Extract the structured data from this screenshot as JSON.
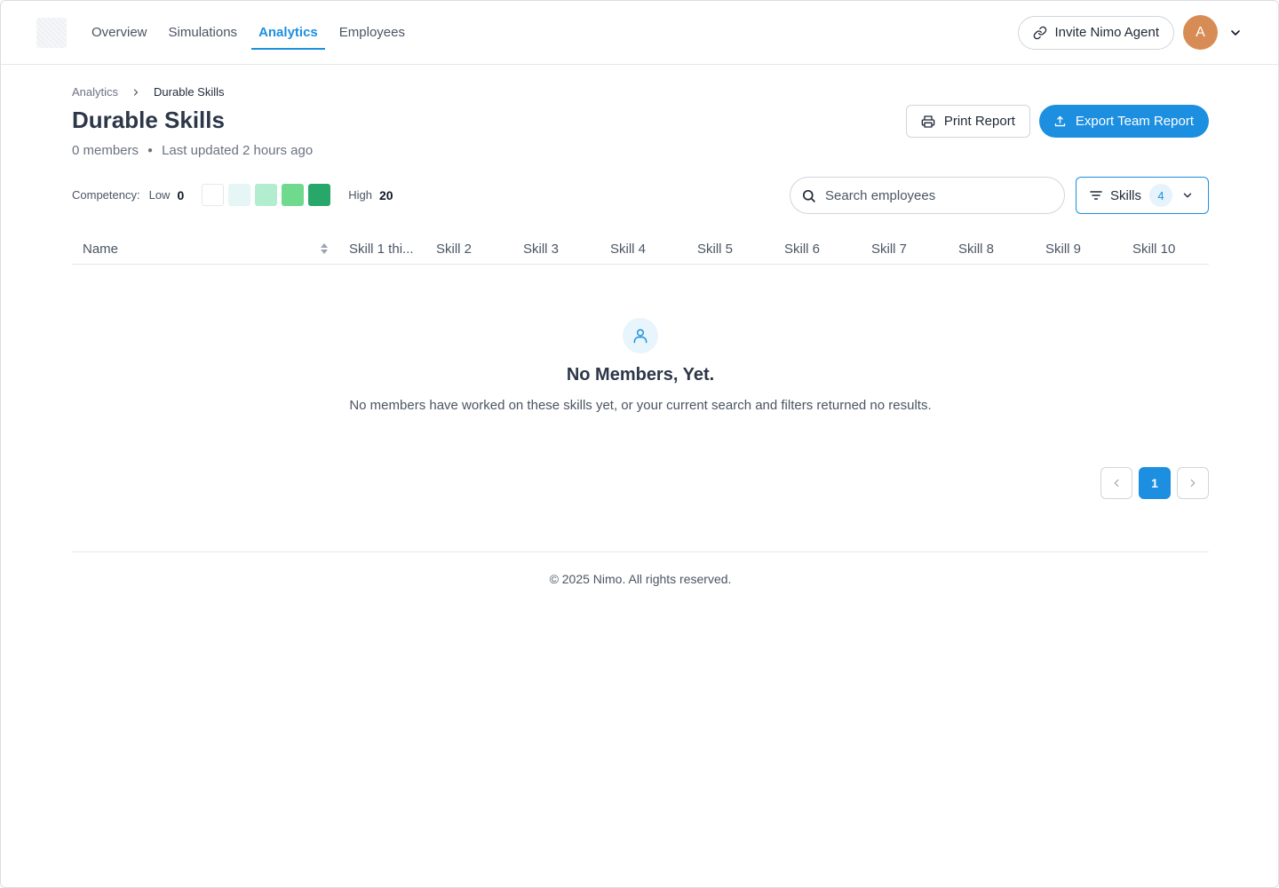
{
  "nav": {
    "items": [
      {
        "label": "Overview",
        "active": false
      },
      {
        "label": "Simulations",
        "active": false
      },
      {
        "label": "Analytics",
        "active": true
      },
      {
        "label": "Employees",
        "active": false
      }
    ],
    "invite_label": "Invite Nimo Agent",
    "avatar_initial": "A",
    "accent_color": "#1d8fe0",
    "avatar_color": "#d88c55"
  },
  "breadcrumb": {
    "parent": "Analytics",
    "current": "Durable Skills"
  },
  "page": {
    "title": "Durable Skills",
    "members": "0 members",
    "updated": "Last updated 2 hours ago",
    "print_label": "Print Report",
    "export_label": "Export Team Report"
  },
  "legend": {
    "label": "Competency:",
    "low_label": "Low",
    "low_value": "0",
    "high_label": "High",
    "high_value": "20",
    "swatch_colors": [
      "#ffffff",
      "#e6f5f6",
      "#b3edcf",
      "#6fd98e",
      "#27a86a"
    ]
  },
  "search": {
    "placeholder": "Search employees"
  },
  "skills_filter": {
    "label": "Skills",
    "count": "4"
  },
  "table": {
    "name_header": "Name",
    "skill_headers": [
      "Skill 1 thi...",
      "Skill 2",
      "Skill 3",
      "Skill 4",
      "Skill 5",
      "Skill 6",
      "Skill 7",
      "Skill 8",
      "Skill 9",
      "Skill 10"
    ]
  },
  "empty_state": {
    "title": "No Members, Yet.",
    "description": "No members have worked on these skills yet, or your current search and filters returned no results."
  },
  "pagination": {
    "current_page": "1"
  },
  "footer": {
    "text": "© 2025 Nimo. All rights reserved."
  }
}
